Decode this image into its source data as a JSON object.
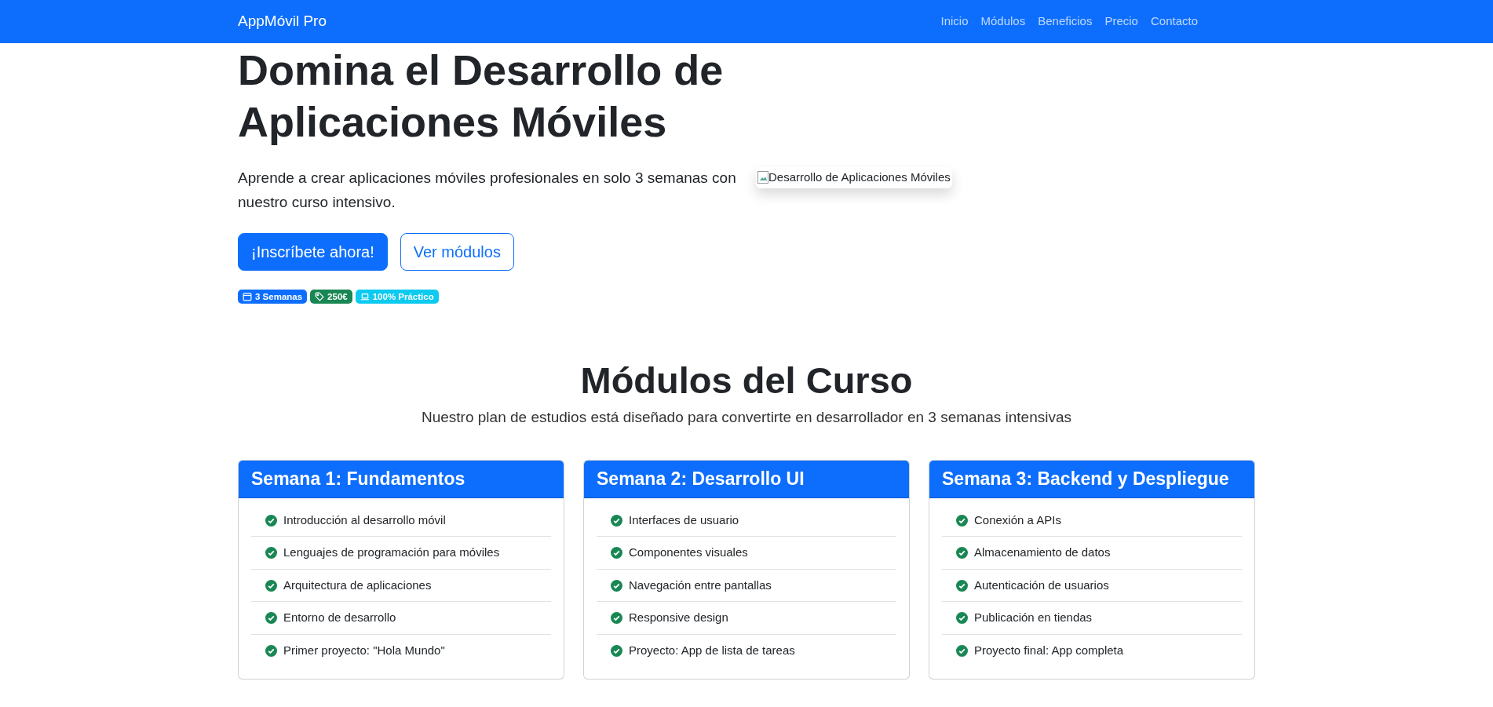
{
  "navbar": {
    "brand": "AppMóvil Pro",
    "links": [
      "Inicio",
      "Módulos",
      "Beneficios",
      "Precio",
      "Contacto"
    ]
  },
  "hero": {
    "title": "Domina el Desarrollo de Aplicaciones Móviles",
    "lead": "Aprende a crear aplicaciones móviles profesionales en solo 3 semanas con nuestro curso intensivo.",
    "buttons": [
      {
        "label": "¡Inscríbete ahora!",
        "kind": "primary"
      },
      {
        "label": "Ver módulos",
        "kind": "outline"
      }
    ],
    "badges": [
      {
        "label": "3 Semanas",
        "kind": "calendar",
        "color": "#0d6efd"
      },
      {
        "label": "250€",
        "kind": "tag",
        "color": "#198754"
      },
      {
        "label": "100% Práctico",
        "kind": "laptop",
        "color": "#0dcaf0"
      }
    ],
    "image_alt": "Desarrollo de Aplicaciones Móviles"
  },
  "modules": {
    "title": "Módulos del Curso",
    "subtitle": "Nuestro plan de estudios está diseñado para convertirte en desarrollador en 3 semanas intensivas",
    "cards": [
      {
        "title": "Semana 1: Fundamentos",
        "items": [
          "Introducción al desarrollo móvil",
          "Lenguajes de programación para móviles",
          "Arquitectura de aplicaciones",
          "Entorno de desarrollo",
          "Primer proyecto: \"Hola Mundo\""
        ]
      },
      {
        "title": "Semana 2: Desarrollo UI",
        "items": [
          "Interfaces de usuario",
          "Componentes visuales",
          "Navegación entre pantallas",
          "Responsive design",
          "Proyecto: App de lista de tareas"
        ]
      },
      {
        "title": "Semana 3: Backend y Despliegue",
        "items": [
          "Conexión a APIs",
          "Almacenamiento de datos",
          "Autenticación de usuarios",
          "Publicación en tiendas",
          "Proyecto final: App completa"
        ]
      }
    ]
  }
}
